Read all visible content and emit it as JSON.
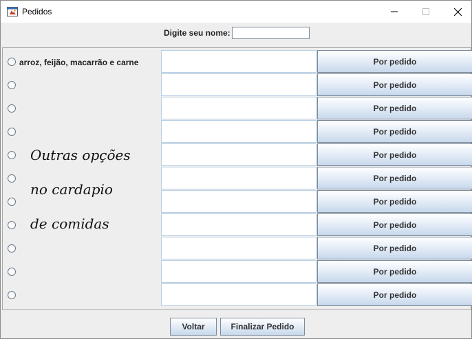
{
  "window": {
    "title": "Pedidos",
    "icon": "java-app-icon"
  },
  "name_field": {
    "label": "Digite seu nome:",
    "value": ""
  },
  "rows": [
    {
      "option_label": "arroz, feijão, macarrão e carne",
      "text_value": "",
      "button_label": "Por pedido"
    },
    {
      "option_label": "",
      "text_value": "",
      "button_label": "Por pedido"
    },
    {
      "option_label": "",
      "text_value": "",
      "button_label": "Por pedido"
    },
    {
      "option_label": "",
      "text_value": "",
      "button_label": "Por pedido"
    },
    {
      "option_label": "",
      "text_value": "",
      "button_label": "Por pedido"
    },
    {
      "option_label": "",
      "text_value": "",
      "button_label": "Por pedido"
    },
    {
      "option_label": "",
      "text_value": "",
      "button_label": "Por pedido"
    },
    {
      "option_label": "",
      "text_value": "",
      "button_label": "Por pedido"
    },
    {
      "option_label": "",
      "text_value": "",
      "button_label": "Por pedido"
    },
    {
      "option_label": "",
      "text_value": "",
      "button_label": "Por pedido"
    },
    {
      "option_label": "",
      "text_value": "",
      "button_label": "Por pedido"
    }
  ],
  "overlay_text": [
    "Outras opções",
    "no cardapio",
    "de comidas"
  ],
  "buttons": {
    "back": "Voltar",
    "finish": "Finalizar Pedido"
  }
}
